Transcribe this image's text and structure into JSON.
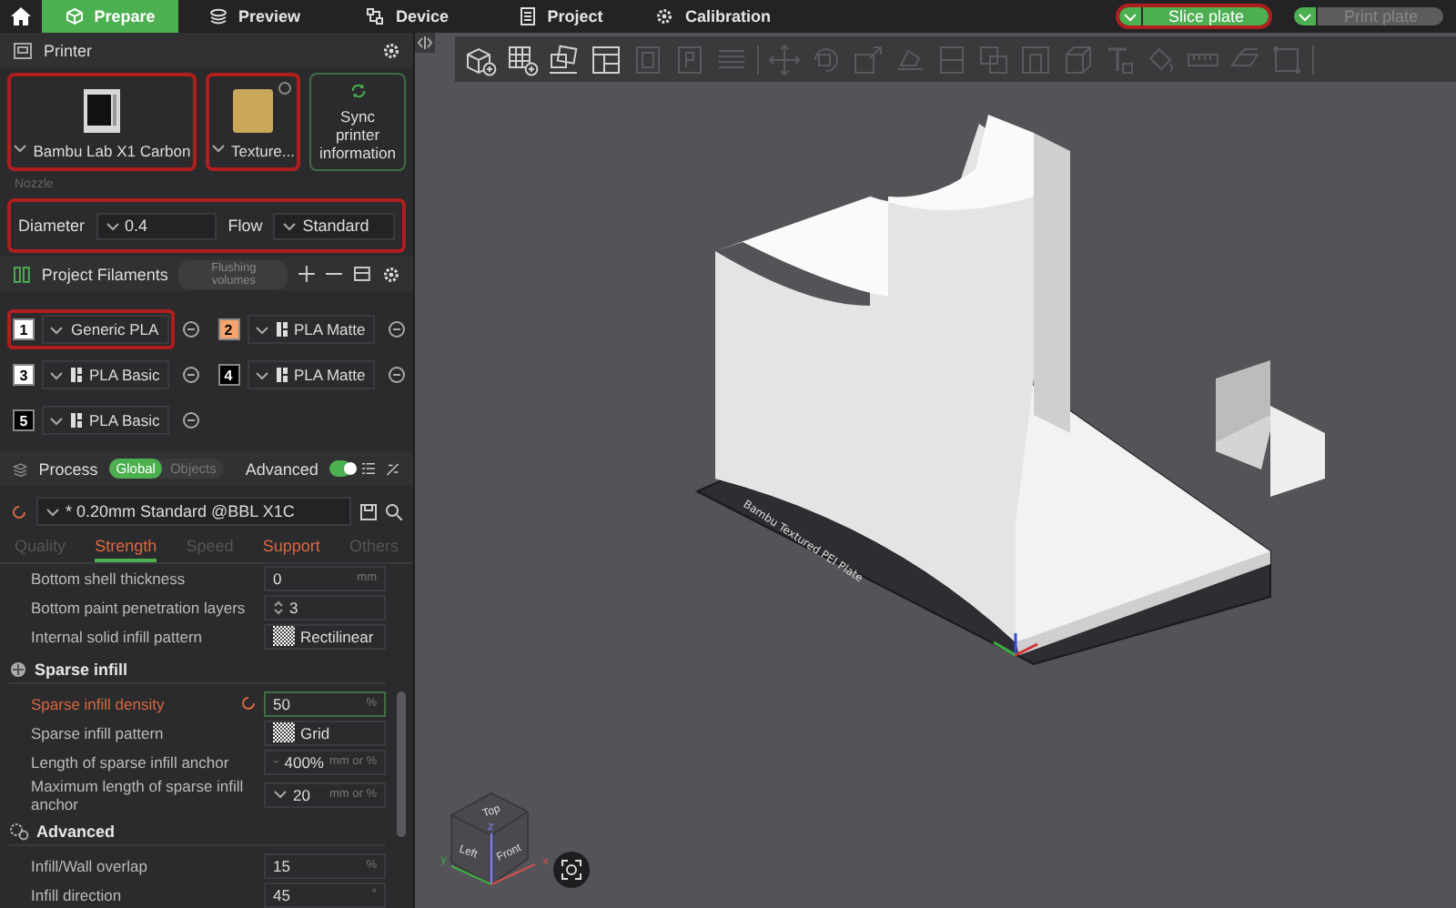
{
  "tabs": [
    {
      "label": "Prepare",
      "selected": true
    },
    {
      "label": "Preview",
      "selected": false
    },
    {
      "label": "Device",
      "selected": false
    },
    {
      "label": "Project",
      "selected": false
    },
    {
      "label": "Calibration",
      "selected": false
    }
  ],
  "actions": [
    {
      "label": "Slice plate",
      "disabled": false,
      "highlighted": true
    },
    {
      "label": "Print plate",
      "disabled": true,
      "highlighted": false
    }
  ],
  "printer": {
    "title": "Printer",
    "cards": [
      {
        "kind": "printer",
        "label": "Bambu Lab X1 Carbon",
        "highlighted": true
      },
      {
        "kind": "plate",
        "label": "Texture...",
        "highlighted": true
      },
      {
        "kind": "sync",
        "label": "Sync printer information",
        "highlighted": false
      }
    ]
  },
  "nozzle": {
    "title": "Nozzle",
    "highlighted": true,
    "fields": [
      {
        "label": "Diameter",
        "value": "0.4"
      },
      {
        "label": "Flow",
        "value": "Standard"
      }
    ]
  },
  "filaments": {
    "title": "Project Filaments",
    "button": "Flushing volumes",
    "items": [
      {
        "number": "1",
        "name": "Generic PLA",
        "color": "#ffffff",
        "branded": false,
        "highlighted": true
      },
      {
        "number": "2",
        "name": "PLA Matte",
        "color": "#f4a46c",
        "branded": true,
        "highlighted": false
      },
      {
        "number": "3",
        "name": "PLA Basic",
        "color": "#ffffff",
        "branded": true,
        "highlighted": false
      },
      {
        "number": "4",
        "name": "PLA Matte",
        "color": "#000000",
        "branded": true,
        "highlighted": false
      },
      {
        "number": "5",
        "name": "PLA Basic",
        "color": "#000000",
        "branded": true,
        "highlighted": false
      }
    ]
  },
  "process": {
    "title": "Process",
    "scopes": [
      {
        "label": "Global",
        "selected": true
      },
      {
        "label": "Objects",
        "selected": false
      }
    ],
    "advanced": {
      "label": "Advanced",
      "on": true
    },
    "preset": "* 0.20mm Standard @BBL X1C",
    "tabs": [
      {
        "label": "Quality",
        "selected": false,
        "modified": false
      },
      {
        "label": "Strength",
        "selected": true,
        "modified": true
      },
      {
        "label": "Speed",
        "selected": false,
        "modified": false
      },
      {
        "label": "Support",
        "selected": false,
        "modified": true
      },
      {
        "label": "Others",
        "selected": false,
        "modified": false
      }
    ],
    "rows": [
      {
        "kind": "text",
        "label": "Bottom shell thickness",
        "value": "0",
        "unit": "mm",
        "modified": false
      },
      {
        "kind": "spin",
        "label": "Bottom paint penetration layers",
        "value": "3",
        "modified": false
      },
      {
        "kind": "pattern",
        "label": "Internal solid infill pattern",
        "value": "Rectilinear",
        "modified": false
      },
      {
        "kind": "header",
        "label": "Sparse infill"
      },
      {
        "kind": "text",
        "label": "Sparse infill density",
        "value": "50",
        "unit": "%",
        "modified": true
      },
      {
        "kind": "pattern",
        "label": "Sparse infill pattern",
        "value": "Grid",
        "modified": false
      },
      {
        "kind": "dropdown",
        "label": "Length of sparse infill anchor",
        "value": "400%",
        "unit": "mm or %",
        "modified": false
      },
      {
        "kind": "dropdown",
        "label": "Maximum length of sparse infill anchor",
        "value": "20",
        "unit": "mm or %",
        "modified": false
      },
      {
        "kind": "header",
        "label": "Advanced"
      },
      {
        "kind": "text",
        "label": "Infill/Wall overlap",
        "value": "15",
        "unit": "%",
        "modified": false
      },
      {
        "kind": "text",
        "label": "Infill direction",
        "value": "45",
        "unit": "°",
        "modified": false
      }
    ]
  },
  "viewport": {
    "plate_label": "Bambu Textured PEI Plate",
    "cube_faces": [
      "Top",
      "Left",
      "Front"
    ],
    "axes": [
      "z",
      "y",
      "x"
    ]
  }
}
